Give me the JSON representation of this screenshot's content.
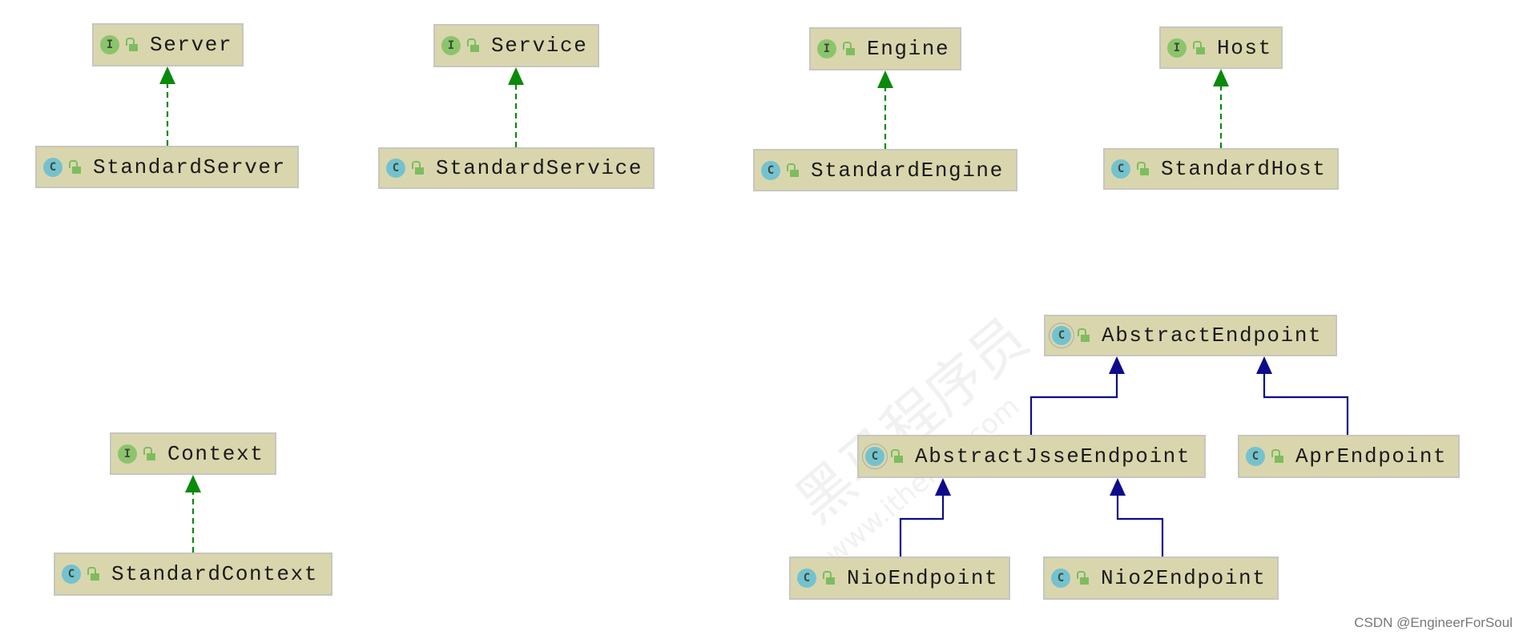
{
  "diagram": {
    "nodes": [
      {
        "id": "Server",
        "kind": "interface",
        "label": "Server"
      },
      {
        "id": "StandardServer",
        "kind": "class",
        "label": "StandardServer"
      },
      {
        "id": "Service",
        "kind": "interface",
        "label": "Service"
      },
      {
        "id": "StandardService",
        "kind": "class",
        "label": "StandardService"
      },
      {
        "id": "Engine",
        "kind": "interface",
        "label": "Engine"
      },
      {
        "id": "StandardEngine",
        "kind": "class",
        "label": "StandardEngine"
      },
      {
        "id": "Host",
        "kind": "interface",
        "label": "Host"
      },
      {
        "id": "StandardHost",
        "kind": "class",
        "label": "StandardHost"
      },
      {
        "id": "Context",
        "kind": "interface",
        "label": "Context"
      },
      {
        "id": "StandardContext",
        "kind": "class",
        "label": "StandardContext"
      },
      {
        "id": "AbstractEndpoint",
        "kind": "abstract-class",
        "label": "AbstractEndpoint"
      },
      {
        "id": "AbstractJsseEndpoint",
        "kind": "abstract-class",
        "label": "AbstractJsseEndpoint"
      },
      {
        "id": "AprEndpoint",
        "kind": "class",
        "label": "AprEndpoint"
      },
      {
        "id": "NioEndpoint",
        "kind": "class",
        "label": "NioEndpoint"
      },
      {
        "id": "Nio2Endpoint",
        "kind": "class",
        "label": "Nio2Endpoint"
      }
    ],
    "edges": [
      {
        "from": "StandardServer",
        "to": "Server",
        "type": "implements"
      },
      {
        "from": "StandardService",
        "to": "Service",
        "type": "implements"
      },
      {
        "from": "StandardEngine",
        "to": "Engine",
        "type": "implements"
      },
      {
        "from": "StandardHost",
        "to": "Host",
        "type": "implements"
      },
      {
        "from": "StandardContext",
        "to": "Context",
        "type": "implements"
      },
      {
        "from": "AbstractJsseEndpoint",
        "to": "AbstractEndpoint",
        "type": "extends"
      },
      {
        "from": "AprEndpoint",
        "to": "AbstractEndpoint",
        "type": "extends"
      },
      {
        "from": "NioEndpoint",
        "to": "AbstractJsseEndpoint",
        "type": "extends"
      },
      {
        "from": "Nio2Endpoint",
        "to": "AbstractJsseEndpoint",
        "type": "extends"
      }
    ],
    "badges": {
      "interface": "I",
      "class": "C",
      "abstract-class": "C"
    },
    "colors": {
      "implements": "#0a8a0a",
      "extends": "#0c0c8c",
      "node_bg": "#d9d6ad"
    }
  },
  "watermark": {
    "logo_text": "黑马程序员",
    "url": "www.itheima.com"
  },
  "credit": "CSDN @EngineerForSoul"
}
